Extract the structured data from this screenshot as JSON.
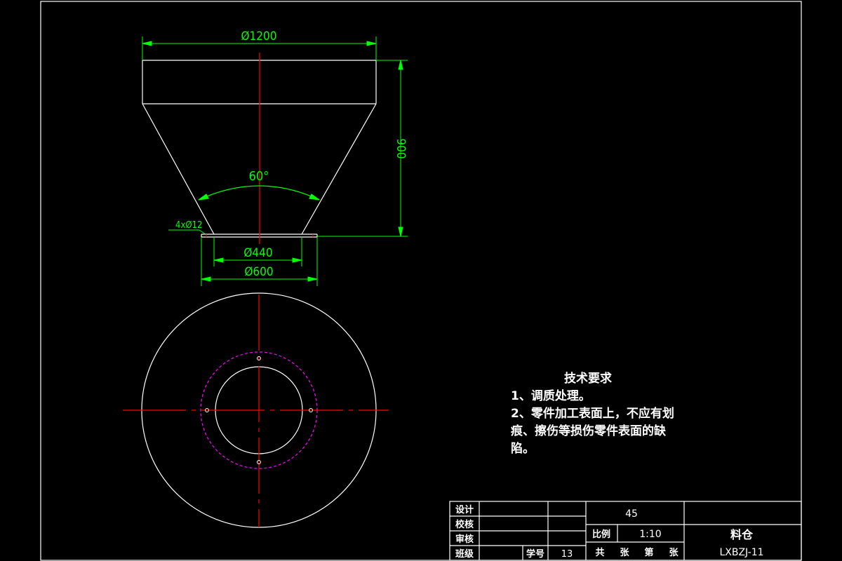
{
  "dimensions": {
    "top_diameter": "Ø1200",
    "height": "900",
    "angle": "60°",
    "holes": "4xØ12",
    "inner_diameter": "Ø440",
    "flange_diameter": "Ø600"
  },
  "technical_requirements": {
    "title": "技术要求",
    "line1": "1、调质处理。",
    "line2": "2、零件加工表面上，不应有划",
    "line3": "痕、擦伤等损伤零件表面的缺",
    "line4": "陷。"
  },
  "title_block": {
    "design": "设计",
    "check": "校核",
    "review": "审核",
    "class": "班级",
    "student_id_label": "学号",
    "student_id": "13",
    "material": "45",
    "scale_label": "比例",
    "scale": "1:10",
    "sheets_total": "共",
    "sheet_unit1": "张",
    "sheet_no": "第",
    "sheet_unit2": "张",
    "part_name": "料仓",
    "drawing_no": "LXBZJ-11"
  },
  "colors": {
    "background": "#000000",
    "outline": "#ffffff",
    "dimension": "#00ff00",
    "centerline": "#ff0000",
    "bolt_circle": "#ff00ff"
  }
}
